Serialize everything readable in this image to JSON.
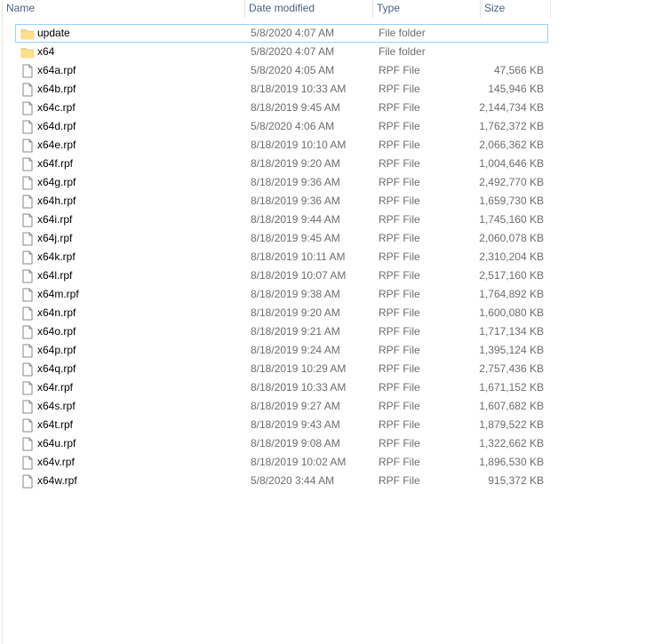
{
  "columns": {
    "name": "Name",
    "date_modified": "Date modified",
    "type": "Type",
    "size": "Size"
  },
  "colors": {
    "folder": "#f8d775",
    "selection_border": "#99d1ff",
    "header_text": "#4c607a",
    "secondary_text": "#6d6d6d"
  },
  "files": [
    {
      "name": "update",
      "date": "5/8/2020 4:07 AM",
      "type": "File folder",
      "size": "",
      "icon": "folder-icon",
      "focused": true
    },
    {
      "name": "x64",
      "date": "5/8/2020 4:07 AM",
      "type": "File folder",
      "size": "",
      "icon": "folder-icon"
    },
    {
      "name": "x64a.rpf",
      "date": "5/8/2020 4:05 AM",
      "type": "RPF File",
      "size": "47,566 KB",
      "icon": "file-icon"
    },
    {
      "name": "x64b.rpf",
      "date": "8/18/2019 10:33 AM",
      "type": "RPF File",
      "size": "145,946 KB",
      "icon": "file-icon"
    },
    {
      "name": "x64c.rpf",
      "date": "8/18/2019 9:45 AM",
      "type": "RPF File",
      "size": "2,144,734 KB",
      "icon": "file-icon"
    },
    {
      "name": "x64d.rpf",
      "date": "5/8/2020 4:06 AM",
      "type": "RPF File",
      "size": "1,762,372 KB",
      "icon": "file-icon"
    },
    {
      "name": "x64e.rpf",
      "date": "8/18/2019 10:10 AM",
      "type": "RPF File",
      "size": "2,066,362 KB",
      "icon": "file-icon"
    },
    {
      "name": "x64f.rpf",
      "date": "8/18/2019 9:20 AM",
      "type": "RPF File",
      "size": "1,004,646 KB",
      "icon": "file-icon"
    },
    {
      "name": "x64g.rpf",
      "date": "8/18/2019 9:36 AM",
      "type": "RPF File",
      "size": "2,492,770 KB",
      "icon": "file-icon"
    },
    {
      "name": "x64h.rpf",
      "date": "8/18/2019 9:36 AM",
      "type": "RPF File",
      "size": "1,659,730 KB",
      "icon": "file-icon"
    },
    {
      "name": "x64i.rpf",
      "date": "8/18/2019 9:44 AM",
      "type": "RPF File",
      "size": "1,745,160 KB",
      "icon": "file-icon"
    },
    {
      "name": "x64j.rpf",
      "date": "8/18/2019 9:45 AM",
      "type": "RPF File",
      "size": "2,060,078 KB",
      "icon": "file-icon"
    },
    {
      "name": "x64k.rpf",
      "date": "8/18/2019 10:11 AM",
      "type": "RPF File",
      "size": "2,310,204 KB",
      "icon": "file-icon"
    },
    {
      "name": "x64l.rpf",
      "date": "8/18/2019 10:07 AM",
      "type": "RPF File",
      "size": "2,517,160 KB",
      "icon": "file-icon"
    },
    {
      "name": "x64m.rpf",
      "date": "8/18/2019 9:38 AM",
      "type": "RPF File",
      "size": "1,764,892 KB",
      "icon": "file-icon"
    },
    {
      "name": "x64n.rpf",
      "date": "8/18/2019 9:20 AM",
      "type": "RPF File",
      "size": "1,600,080 KB",
      "icon": "file-icon"
    },
    {
      "name": "x64o.rpf",
      "date": "8/18/2019 9:21 AM",
      "type": "RPF File",
      "size": "1,717,134 KB",
      "icon": "file-icon"
    },
    {
      "name": "x64p.rpf",
      "date": "8/18/2019 9:24 AM",
      "type": "RPF File",
      "size": "1,395,124 KB",
      "icon": "file-icon"
    },
    {
      "name": "x64q.rpf",
      "date": "8/18/2019 10:29 AM",
      "type": "RPF File",
      "size": "2,757,436 KB",
      "icon": "file-icon"
    },
    {
      "name": "x64r.rpf",
      "date": "8/18/2019 10:33 AM",
      "type": "RPF File",
      "size": "1,671,152 KB",
      "icon": "file-icon"
    },
    {
      "name": "x64s.rpf",
      "date": "8/18/2019 9:27 AM",
      "type": "RPF File",
      "size": "1,607,682 KB",
      "icon": "file-icon"
    },
    {
      "name": "x64t.rpf",
      "date": "8/18/2019 9:43 AM",
      "type": "RPF File",
      "size": "1,879,522 KB",
      "icon": "file-icon"
    },
    {
      "name": "x64u.rpf",
      "date": "8/18/2019 9:08 AM",
      "type": "RPF File",
      "size": "1,322,662 KB",
      "icon": "file-icon"
    },
    {
      "name": "x64v.rpf",
      "date": "8/18/2019 10:02 AM",
      "type": "RPF File",
      "size": "1,896,530 KB",
      "icon": "file-icon"
    },
    {
      "name": "x64w.rpf",
      "date": "5/8/2020 3:44 AM",
      "type": "RPF File",
      "size": "915,372 KB",
      "icon": "file-icon"
    }
  ]
}
